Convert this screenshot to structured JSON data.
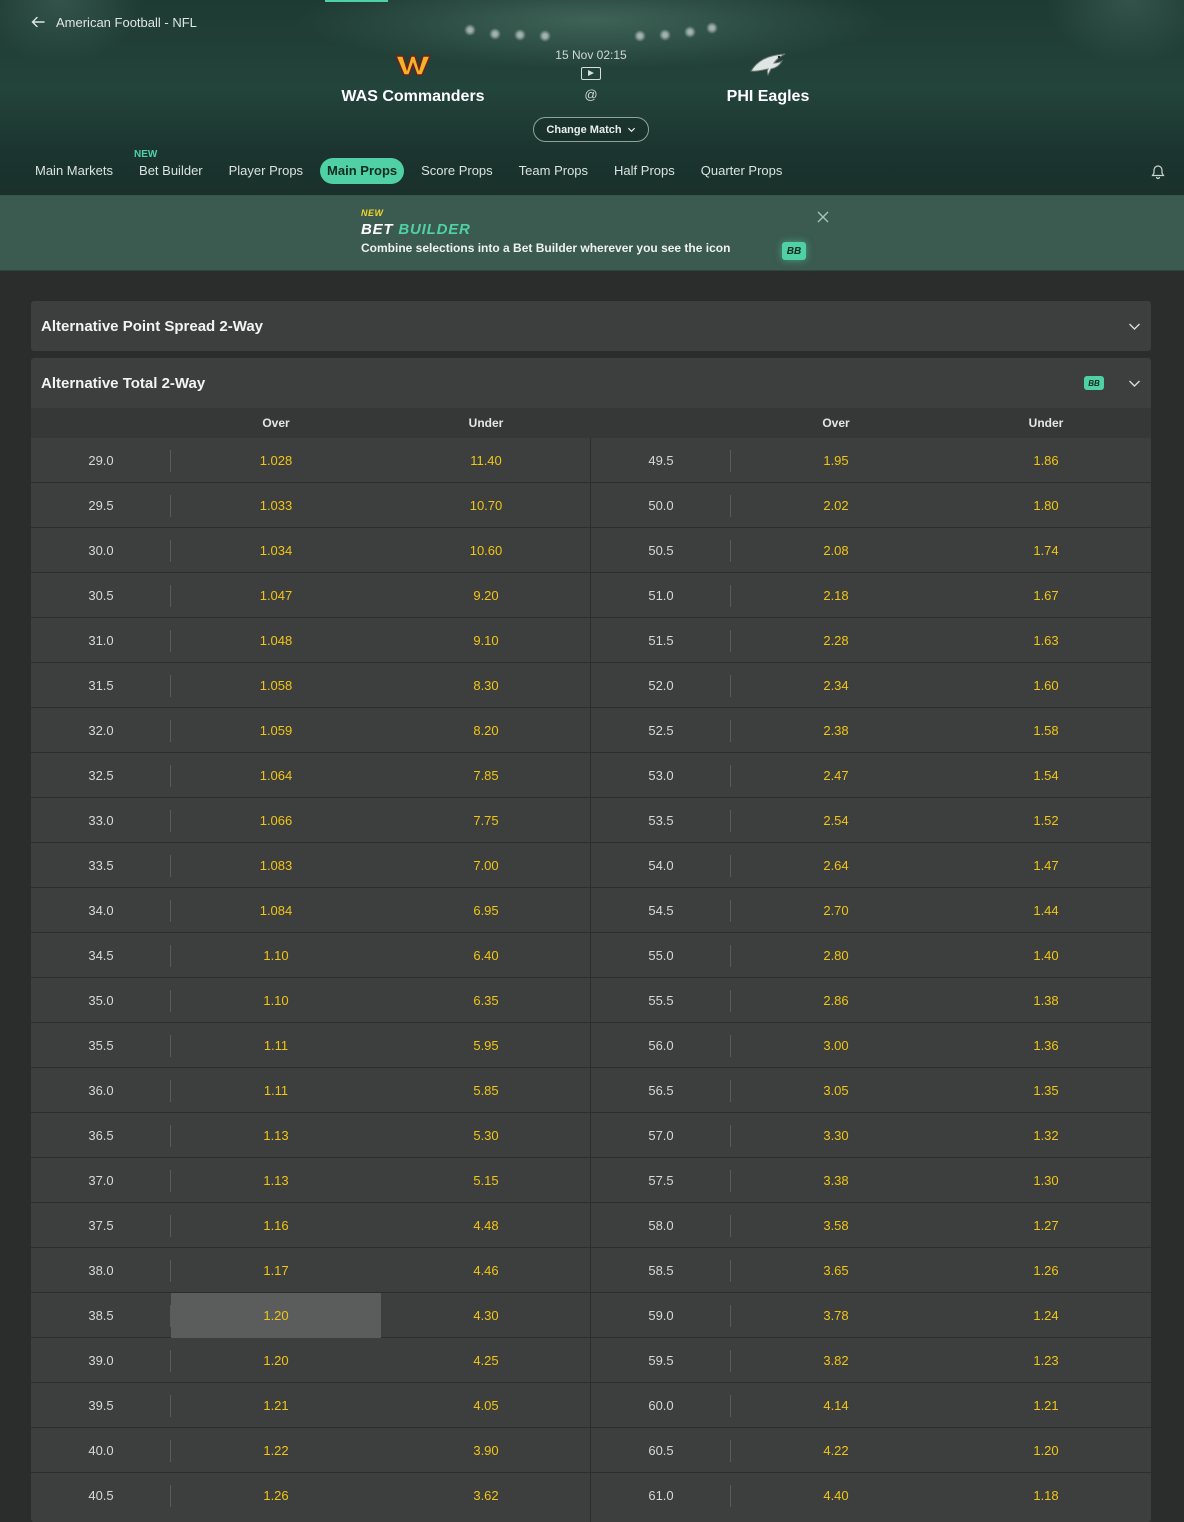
{
  "breadcrumb": {
    "label": "American Football - NFL"
  },
  "match": {
    "home_team": "WAS Commanders",
    "away_team": "PHI Eagles",
    "datetime": "15 Nov 02:15",
    "separator": "@",
    "change_match_label": "Change Match"
  },
  "tabs": [
    {
      "label": "Main Markets"
    },
    {
      "label": "Bet Builder",
      "badge": "NEW"
    },
    {
      "label": "Player Props"
    },
    {
      "label": "Main Props",
      "active": true
    },
    {
      "label": "Score Props"
    },
    {
      "label": "Team Props"
    },
    {
      "label": "Half Props"
    },
    {
      "label": "Quarter Props"
    }
  ],
  "banner": {
    "new_label": "NEW",
    "title_part1": "BET",
    "title_part2": "BUILDER",
    "description": "Combine selections into a Bet Builder wherever you see the icon",
    "badge": "BB"
  },
  "markets": {
    "spread": {
      "title": "Alternative Point Spread 2-Way"
    },
    "total": {
      "title": "Alternative Total 2-Way",
      "badge": "BB",
      "headers": {
        "over": "Over",
        "under": "Under"
      },
      "selected": {
        "side": "left",
        "row": 19,
        "column": "over"
      },
      "left": [
        [
          "29.0",
          "1.028",
          "11.40"
        ],
        [
          "29.5",
          "1.033",
          "10.70"
        ],
        [
          "30.0",
          "1.034",
          "10.60"
        ],
        [
          "30.5",
          "1.047",
          "9.20"
        ],
        [
          "31.0",
          "1.048",
          "9.10"
        ],
        [
          "31.5",
          "1.058",
          "8.30"
        ],
        [
          "32.0",
          "1.059",
          "8.20"
        ],
        [
          "32.5",
          "1.064",
          "7.85"
        ],
        [
          "33.0",
          "1.066",
          "7.75"
        ],
        [
          "33.5",
          "1.083",
          "7.00"
        ],
        [
          "34.0",
          "1.084",
          "6.95"
        ],
        [
          "34.5",
          "1.10",
          "6.40"
        ],
        [
          "35.0",
          "1.10",
          "6.35"
        ],
        [
          "35.5",
          "1.11",
          "5.95"
        ],
        [
          "36.0",
          "1.11",
          "5.85"
        ],
        [
          "36.5",
          "1.13",
          "5.30"
        ],
        [
          "37.0",
          "1.13",
          "5.15"
        ],
        [
          "37.5",
          "1.16",
          "4.48"
        ],
        [
          "38.0",
          "1.17",
          "4.46"
        ],
        [
          "38.5",
          "1.20",
          "4.30"
        ],
        [
          "39.0",
          "1.20",
          "4.25"
        ],
        [
          "39.5",
          "1.21",
          "4.05"
        ],
        [
          "40.0",
          "1.22",
          "3.90"
        ],
        [
          "40.5",
          "1.26",
          "3.62"
        ]
      ],
      "right": [
        [
          "49.5",
          "1.95",
          "1.86"
        ],
        [
          "50.0",
          "2.02",
          "1.80"
        ],
        [
          "50.5",
          "2.08",
          "1.74"
        ],
        [
          "51.0",
          "2.18",
          "1.67"
        ],
        [
          "51.5",
          "2.28",
          "1.63"
        ],
        [
          "52.0",
          "2.34",
          "1.60"
        ],
        [
          "52.5",
          "2.38",
          "1.58"
        ],
        [
          "53.0",
          "2.47",
          "1.54"
        ],
        [
          "53.5",
          "2.54",
          "1.52"
        ],
        [
          "54.0",
          "2.64",
          "1.47"
        ],
        [
          "54.5",
          "2.70",
          "1.44"
        ],
        [
          "55.0",
          "2.80",
          "1.40"
        ],
        [
          "55.5",
          "2.86",
          "1.38"
        ],
        [
          "56.0",
          "3.00",
          "1.36"
        ],
        [
          "56.5",
          "3.05",
          "1.35"
        ],
        [
          "57.0",
          "3.30",
          "1.32"
        ],
        [
          "57.5",
          "3.38",
          "1.30"
        ],
        [
          "58.0",
          "3.58",
          "1.27"
        ],
        [
          "58.5",
          "3.65",
          "1.26"
        ],
        [
          "59.0",
          "3.78",
          "1.24"
        ],
        [
          "59.5",
          "3.82",
          "1.23"
        ],
        [
          "60.0",
          "4.14",
          "1.21"
        ],
        [
          "60.5",
          "4.22",
          "1.20"
        ],
        [
          "61.0",
          "4.40",
          "1.18"
        ]
      ]
    }
  },
  "colors": {
    "accent": "#4fd1a5",
    "odds": "#f2c515",
    "panel": "#3d3f3e"
  },
  "icons": [
    "back-arrow-icon",
    "commanders-logo",
    "eagles-logo",
    "tv-icon",
    "chevron-down-icon",
    "bell-icon",
    "close-icon",
    "bet-builder-icon"
  ]
}
